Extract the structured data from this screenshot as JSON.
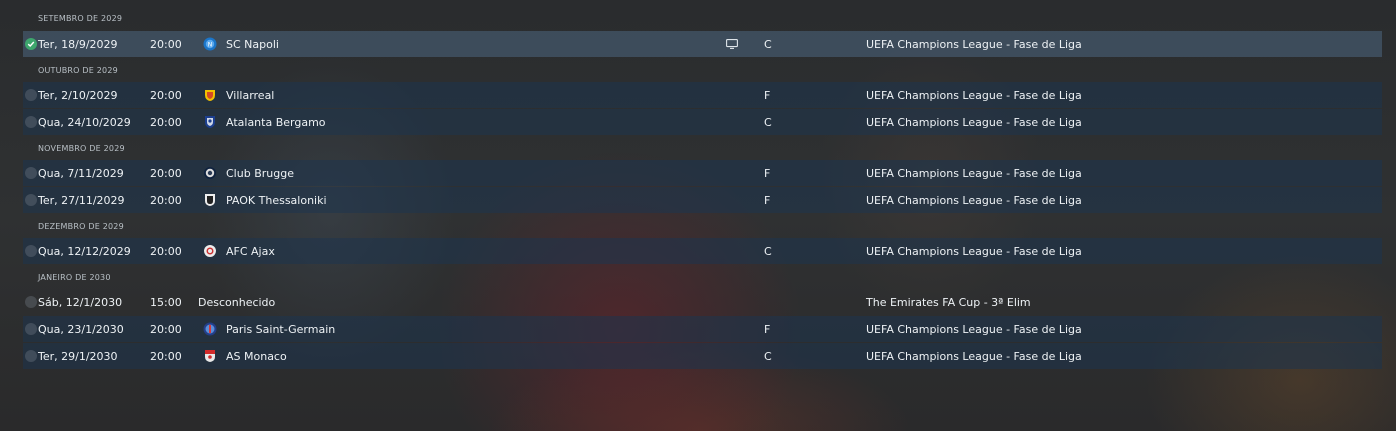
{
  "schedule": [
    {
      "month": "SETEMBRO DE 2029",
      "matches": [
        {
          "date": "Ter, 18/9/2029",
          "time": "20:00",
          "opponent": "SC Napoli",
          "crest": "napoli-crest-icon",
          "venue": "C",
          "competition": "UEFA Champions League - Fase de Liga",
          "played": true,
          "tv": true,
          "selected": true
        }
      ]
    },
    {
      "month": "OUTUBRO DE 2029",
      "matches": [
        {
          "date": "Ter, 2/10/2029",
          "time": "20:00",
          "opponent": "Villarreal",
          "crest": "villarreal-crest-icon",
          "venue": "F",
          "competition": "UEFA Champions League - Fase de Liga"
        },
        {
          "date": "Qua, 24/10/2029",
          "time": "20:00",
          "opponent": "Atalanta Bergamo",
          "crest": "atalanta-crest-icon",
          "venue": "C",
          "competition": "UEFA Champions League - Fase de Liga"
        }
      ]
    },
    {
      "month": "NOVEMBRO DE 2029",
      "matches": [
        {
          "date": "Qua, 7/11/2029",
          "time": "20:00",
          "opponent": "Club Brugge",
          "crest": "club-brugge-crest-icon",
          "venue": "F",
          "competition": "UEFA Champions League - Fase de Liga"
        },
        {
          "date": "Ter, 27/11/2029",
          "time": "20:00",
          "opponent": "PAOK Thessaloniki",
          "crest": "paok-crest-icon",
          "venue": "F",
          "competition": "UEFA Champions League - Fase de Liga"
        }
      ]
    },
    {
      "month": "DEZEMBRO DE 2029",
      "matches": [
        {
          "date": "Qua, 12/12/2029",
          "time": "20:00",
          "opponent": "AFC Ajax",
          "crest": "ajax-crest-icon",
          "venue": "C",
          "competition": "UEFA Champions League - Fase de Liga"
        }
      ]
    },
    {
      "month": "JANEIRO DE 2030",
      "matches": [
        {
          "date": "Sáb, 12/1/2030",
          "time": "15:00",
          "opponent": "Desconhecido",
          "crest": "",
          "venue": "",
          "competition": "The Emirates FA Cup - 3ª Elim",
          "plain": true
        },
        {
          "date": "Qua, 23/1/2030",
          "time": "20:00",
          "opponent": "Paris Saint-Germain",
          "crest": "psg-crest-icon",
          "venue": "F",
          "competition": "UEFA Champions League - Fase de Liga"
        },
        {
          "date": "Ter, 29/1/2030",
          "time": "20:00",
          "opponent": "AS Monaco",
          "crest": "monaco-crest-icon",
          "venue": "C",
          "competition": "UEFA Champions League - Fase de Liga"
        }
      ]
    }
  ],
  "colors": {
    "row_bg": "#1e344e",
    "selected_row_bg": "#465a6e",
    "check_on": "#3ea66d"
  }
}
